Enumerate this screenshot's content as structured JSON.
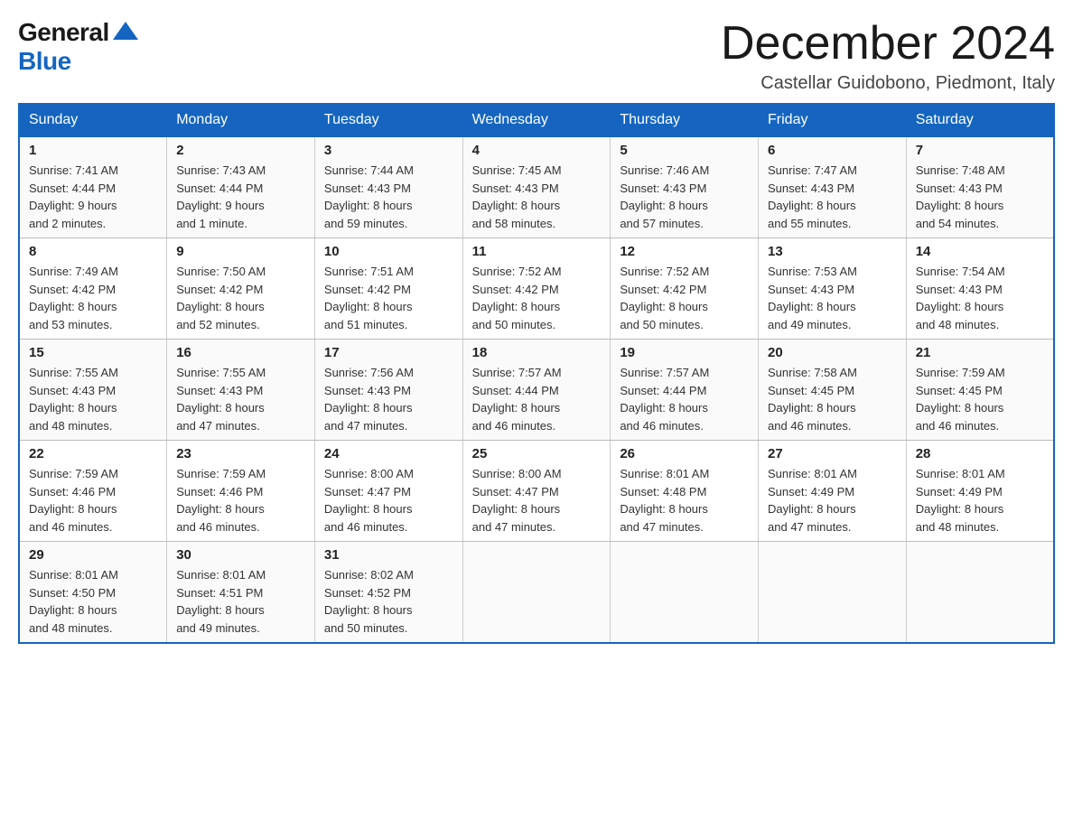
{
  "header": {
    "logo_general": "General",
    "logo_blue": "Blue",
    "title": "December 2024",
    "subtitle": "Castellar Guidobono, Piedmont, Italy"
  },
  "days_of_week": [
    "Sunday",
    "Monday",
    "Tuesday",
    "Wednesday",
    "Thursday",
    "Friday",
    "Saturday"
  ],
  "weeks": [
    [
      {
        "day": "1",
        "sunrise": "Sunrise: 7:41 AM",
        "sunset": "Sunset: 4:44 PM",
        "daylight": "Daylight: 9 hours",
        "daylight2": "and 2 minutes."
      },
      {
        "day": "2",
        "sunrise": "Sunrise: 7:43 AM",
        "sunset": "Sunset: 4:44 PM",
        "daylight": "Daylight: 9 hours",
        "daylight2": "and 1 minute."
      },
      {
        "day": "3",
        "sunrise": "Sunrise: 7:44 AM",
        "sunset": "Sunset: 4:43 PM",
        "daylight": "Daylight: 8 hours",
        "daylight2": "and 59 minutes."
      },
      {
        "day": "4",
        "sunrise": "Sunrise: 7:45 AM",
        "sunset": "Sunset: 4:43 PM",
        "daylight": "Daylight: 8 hours",
        "daylight2": "and 58 minutes."
      },
      {
        "day": "5",
        "sunrise": "Sunrise: 7:46 AM",
        "sunset": "Sunset: 4:43 PM",
        "daylight": "Daylight: 8 hours",
        "daylight2": "and 57 minutes."
      },
      {
        "day": "6",
        "sunrise": "Sunrise: 7:47 AM",
        "sunset": "Sunset: 4:43 PM",
        "daylight": "Daylight: 8 hours",
        "daylight2": "and 55 minutes."
      },
      {
        "day": "7",
        "sunrise": "Sunrise: 7:48 AM",
        "sunset": "Sunset: 4:43 PM",
        "daylight": "Daylight: 8 hours",
        "daylight2": "and 54 minutes."
      }
    ],
    [
      {
        "day": "8",
        "sunrise": "Sunrise: 7:49 AM",
        "sunset": "Sunset: 4:42 PM",
        "daylight": "Daylight: 8 hours",
        "daylight2": "and 53 minutes."
      },
      {
        "day": "9",
        "sunrise": "Sunrise: 7:50 AM",
        "sunset": "Sunset: 4:42 PM",
        "daylight": "Daylight: 8 hours",
        "daylight2": "and 52 minutes."
      },
      {
        "day": "10",
        "sunrise": "Sunrise: 7:51 AM",
        "sunset": "Sunset: 4:42 PM",
        "daylight": "Daylight: 8 hours",
        "daylight2": "and 51 minutes."
      },
      {
        "day": "11",
        "sunrise": "Sunrise: 7:52 AM",
        "sunset": "Sunset: 4:42 PM",
        "daylight": "Daylight: 8 hours",
        "daylight2": "and 50 minutes."
      },
      {
        "day": "12",
        "sunrise": "Sunrise: 7:52 AM",
        "sunset": "Sunset: 4:42 PM",
        "daylight": "Daylight: 8 hours",
        "daylight2": "and 50 minutes."
      },
      {
        "day": "13",
        "sunrise": "Sunrise: 7:53 AM",
        "sunset": "Sunset: 4:43 PM",
        "daylight": "Daylight: 8 hours",
        "daylight2": "and 49 minutes."
      },
      {
        "day": "14",
        "sunrise": "Sunrise: 7:54 AM",
        "sunset": "Sunset: 4:43 PM",
        "daylight": "Daylight: 8 hours",
        "daylight2": "and 48 minutes."
      }
    ],
    [
      {
        "day": "15",
        "sunrise": "Sunrise: 7:55 AM",
        "sunset": "Sunset: 4:43 PM",
        "daylight": "Daylight: 8 hours",
        "daylight2": "and 48 minutes."
      },
      {
        "day": "16",
        "sunrise": "Sunrise: 7:55 AM",
        "sunset": "Sunset: 4:43 PM",
        "daylight": "Daylight: 8 hours",
        "daylight2": "and 47 minutes."
      },
      {
        "day": "17",
        "sunrise": "Sunrise: 7:56 AM",
        "sunset": "Sunset: 4:43 PM",
        "daylight": "Daylight: 8 hours",
        "daylight2": "and 47 minutes."
      },
      {
        "day": "18",
        "sunrise": "Sunrise: 7:57 AM",
        "sunset": "Sunset: 4:44 PM",
        "daylight": "Daylight: 8 hours",
        "daylight2": "and 46 minutes."
      },
      {
        "day": "19",
        "sunrise": "Sunrise: 7:57 AM",
        "sunset": "Sunset: 4:44 PM",
        "daylight": "Daylight: 8 hours",
        "daylight2": "and 46 minutes."
      },
      {
        "day": "20",
        "sunrise": "Sunrise: 7:58 AM",
        "sunset": "Sunset: 4:45 PM",
        "daylight": "Daylight: 8 hours",
        "daylight2": "and 46 minutes."
      },
      {
        "day": "21",
        "sunrise": "Sunrise: 7:59 AM",
        "sunset": "Sunset: 4:45 PM",
        "daylight": "Daylight: 8 hours",
        "daylight2": "and 46 minutes."
      }
    ],
    [
      {
        "day": "22",
        "sunrise": "Sunrise: 7:59 AM",
        "sunset": "Sunset: 4:46 PM",
        "daylight": "Daylight: 8 hours",
        "daylight2": "and 46 minutes."
      },
      {
        "day": "23",
        "sunrise": "Sunrise: 7:59 AM",
        "sunset": "Sunset: 4:46 PM",
        "daylight": "Daylight: 8 hours",
        "daylight2": "and 46 minutes."
      },
      {
        "day": "24",
        "sunrise": "Sunrise: 8:00 AM",
        "sunset": "Sunset: 4:47 PM",
        "daylight": "Daylight: 8 hours",
        "daylight2": "and 46 minutes."
      },
      {
        "day": "25",
        "sunrise": "Sunrise: 8:00 AM",
        "sunset": "Sunset: 4:47 PM",
        "daylight": "Daylight: 8 hours",
        "daylight2": "and 47 minutes."
      },
      {
        "day": "26",
        "sunrise": "Sunrise: 8:01 AM",
        "sunset": "Sunset: 4:48 PM",
        "daylight": "Daylight: 8 hours",
        "daylight2": "and 47 minutes."
      },
      {
        "day": "27",
        "sunrise": "Sunrise: 8:01 AM",
        "sunset": "Sunset: 4:49 PM",
        "daylight": "Daylight: 8 hours",
        "daylight2": "and 47 minutes."
      },
      {
        "day": "28",
        "sunrise": "Sunrise: 8:01 AM",
        "sunset": "Sunset: 4:49 PM",
        "daylight": "Daylight: 8 hours",
        "daylight2": "and 48 minutes."
      }
    ],
    [
      {
        "day": "29",
        "sunrise": "Sunrise: 8:01 AM",
        "sunset": "Sunset: 4:50 PM",
        "daylight": "Daylight: 8 hours",
        "daylight2": "and 48 minutes."
      },
      {
        "day": "30",
        "sunrise": "Sunrise: 8:01 AM",
        "sunset": "Sunset: 4:51 PM",
        "daylight": "Daylight: 8 hours",
        "daylight2": "and 49 minutes."
      },
      {
        "day": "31",
        "sunrise": "Sunrise: 8:02 AM",
        "sunset": "Sunset: 4:52 PM",
        "daylight": "Daylight: 8 hours",
        "daylight2": "and 50 minutes."
      },
      null,
      null,
      null,
      null
    ]
  ]
}
